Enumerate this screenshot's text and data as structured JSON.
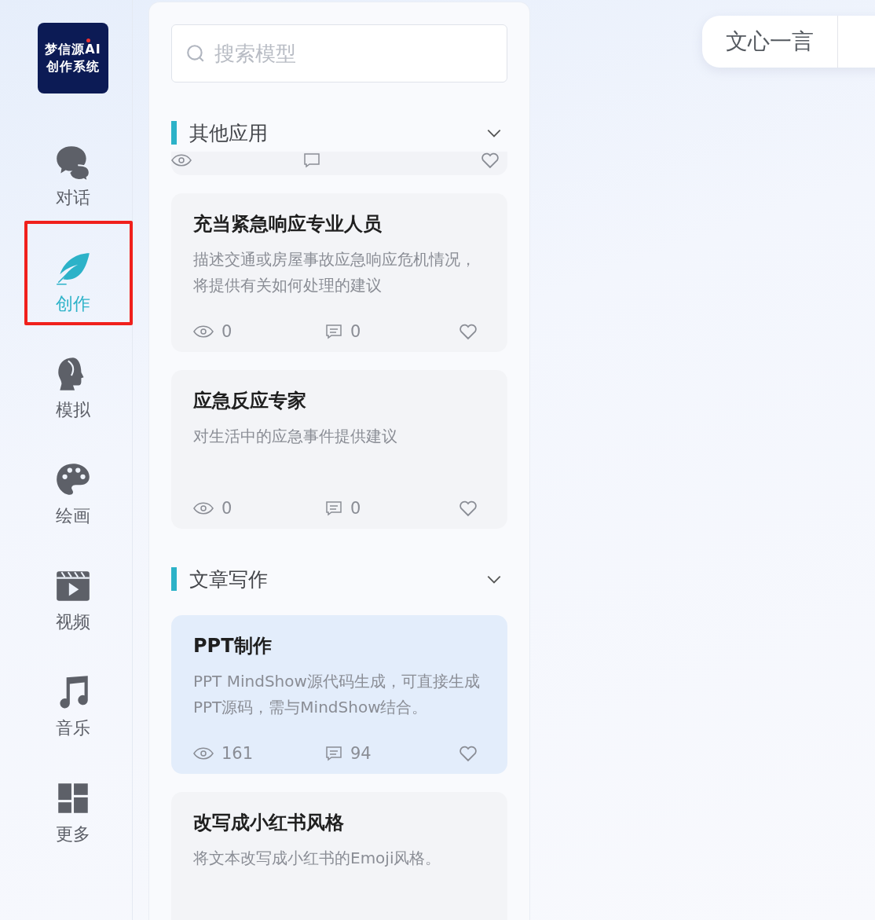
{
  "logo": {
    "lines": [
      "梦信源AI",
      "创作系统"
    ]
  },
  "nav": [
    {
      "label": "对话",
      "kind": "chat",
      "selected": false
    },
    {
      "label": "创作",
      "kind": "feather",
      "selected": true
    },
    {
      "label": "模拟",
      "kind": "head",
      "selected": false
    },
    {
      "label": "绘画",
      "kind": "palette",
      "selected": false
    },
    {
      "label": "视频",
      "kind": "video",
      "selected": false
    },
    {
      "label": "音乐",
      "kind": "music",
      "selected": false
    },
    {
      "label": "更多",
      "kind": "grid",
      "selected": false
    }
  ],
  "search": {
    "placeholder": "搜索模型"
  },
  "sections": [
    {
      "title": "其他应用",
      "partial_card": true,
      "cards": [
        {
          "title": "充当紧急响应专业人员",
          "description": "描述交通或房屋事故应急响应危机情况，将提供有关如何处理的建议",
          "views": "0",
          "comments": "0",
          "highlighted": false
        },
        {
          "title": "应急反应专家",
          "description": "对生活中的应急事件提供建议",
          "views": "0",
          "comments": "0",
          "highlighted": false
        }
      ]
    },
    {
      "title": "文章写作",
      "cards": [
        {
          "title": "PPT制作",
          "description": "PPT MindShow源代码生成，可直接生成PPT源码，需与MindShow结合。",
          "views": "161",
          "comments": "94",
          "highlighted": true
        },
        {
          "title": "改写成小红书风格",
          "description": "将文本改写成小红书的Emoji风格。",
          "highlighted": false
        }
      ]
    }
  ],
  "model_tabs": [
    {
      "label": "文心一言"
    }
  ]
}
